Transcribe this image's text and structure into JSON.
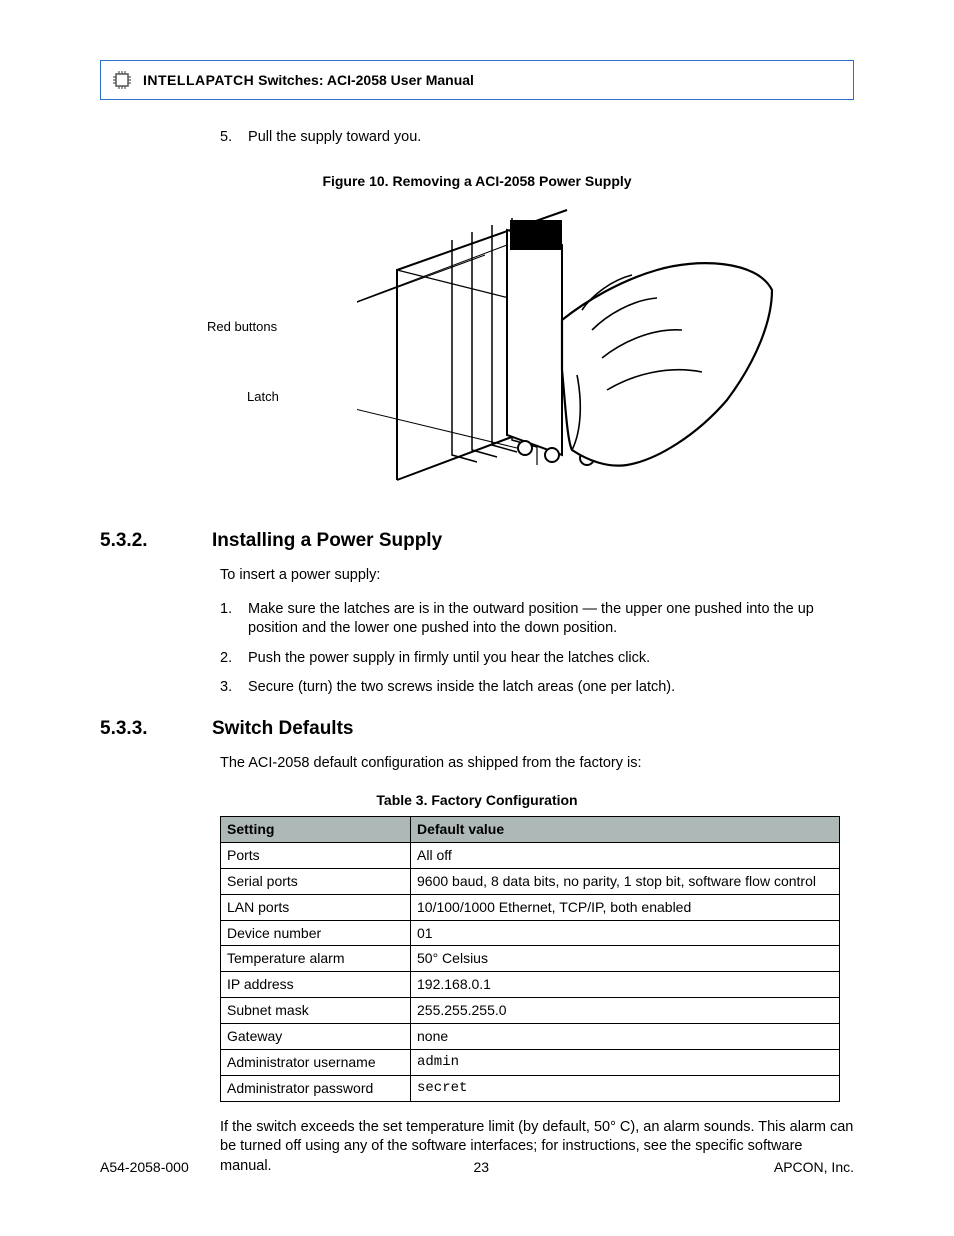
{
  "header": {
    "brand": "INTELLAPATCH",
    "rest": " Switches: ACI-2058 User Manual"
  },
  "step5": {
    "num": "5.",
    "text": "Pull the supply toward you."
  },
  "figure": {
    "caption": "Figure 10. Removing a ACI-2058 Power Supply",
    "callout_red": "Red buttons",
    "callout_latch": "Latch"
  },
  "sec532": {
    "num": "5.3.2.",
    "title": "Installing a Power Supply",
    "intro": "To insert a power supply:",
    "steps": [
      {
        "n": "1.",
        "t": "Make sure the latches are is in the outward position — the upper one pushed into the up position and the lower one pushed into the down position."
      },
      {
        "n": "2.",
        "t": "Push the power supply in firmly until you hear the latches click."
      },
      {
        "n": "3.",
        "t": "Secure (turn) the two screws inside the latch areas (one per latch)."
      }
    ]
  },
  "sec533": {
    "num": "5.3.3.",
    "title": "Switch Defaults",
    "intro": "The ACI-2058 default configuration as shipped from the factory is:",
    "tableCaption": "Table 3. Factory Configuration",
    "headers": {
      "c1": "Setting",
      "c2": "Default value"
    },
    "rows": [
      {
        "s": "Ports",
        "v": "All off",
        "mono": false
      },
      {
        "s": "Serial ports",
        "v": "9600 baud, 8 data bits, no parity, 1 stop bit, software flow control",
        "mono": false
      },
      {
        "s": "LAN ports",
        "v": "10/100/1000 Ethernet, TCP/IP, both enabled",
        "mono": false
      },
      {
        "s": "Device number",
        "v": "01",
        "mono": false
      },
      {
        "s": "Temperature alarm",
        "v": "50° Celsius",
        "mono": false
      },
      {
        "s": "IP address",
        "v": "192.168.0.1",
        "mono": false
      },
      {
        "s": "Subnet mask",
        "v": "255.255.255.0",
        "mono": false
      },
      {
        "s": "Gateway",
        "v": "none",
        "mono": false
      },
      {
        "s": "Administrator username",
        "v": "admin",
        "mono": true
      },
      {
        "s": "Administrator password",
        "v": "secret",
        "mono": true
      }
    ],
    "after": "If the switch exceeds the set temperature limit (by default, 50° C), an alarm sounds. This alarm can be turned off using any of the software interfaces; for instructions, see the specific software manual."
  },
  "footer": {
    "left": "A54-2058-000",
    "center": "23",
    "right": "APCON, Inc."
  }
}
